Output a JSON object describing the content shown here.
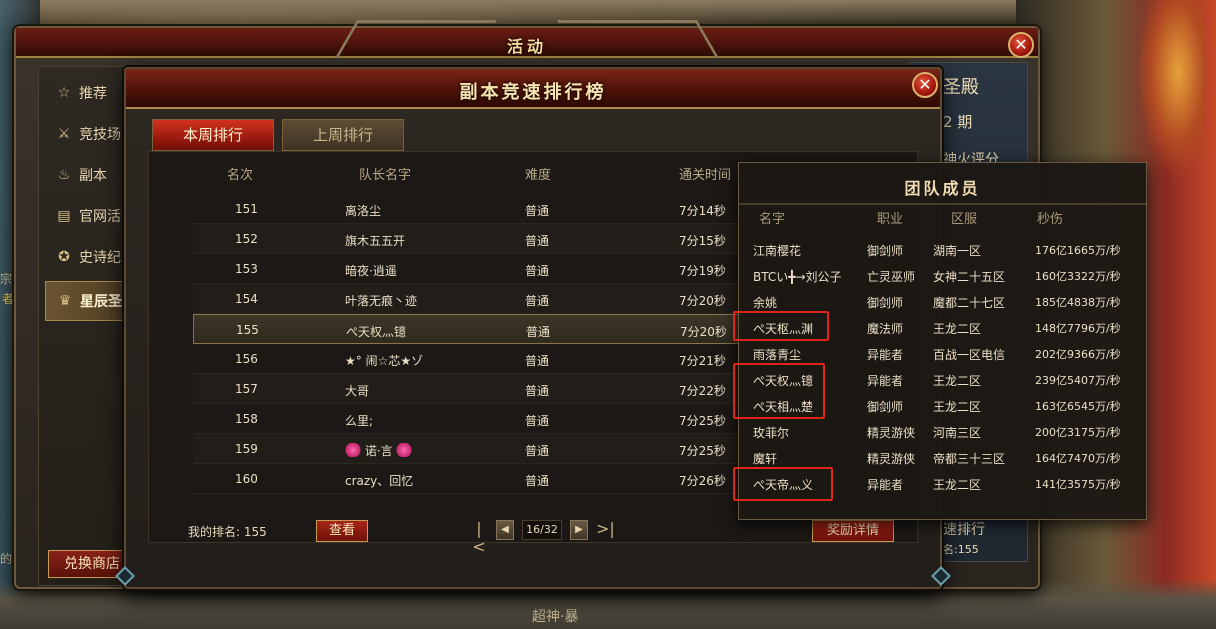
{
  "background": {
    "left_text": [
      "宗帝",
      "者",
      "的"
    ],
    "bottom_text": "超神·暴"
  },
  "outer_window": {
    "title": "活动",
    "close_glyph": "✕"
  },
  "sidebar": {
    "items": [
      {
        "label": "推荐",
        "icon": "star-icon",
        "glyph": "☆"
      },
      {
        "label": "竞技场",
        "icon": "crossed-swords-icon",
        "glyph": "⚔"
      },
      {
        "label": "副本",
        "icon": "flame-icon",
        "glyph": "♨"
      },
      {
        "label": "官网活",
        "icon": "book-icon",
        "glyph": "▤"
      },
      {
        "label": "史诗纪",
        "icon": "emblem-icon",
        "glyph": "✪"
      },
      {
        "label": "星辰圣",
        "icon": "trophy-icon",
        "glyph": "♛",
        "active": true
      }
    ],
    "shop_label": "兑换商店"
  },
  "right_panel": {
    "title": "圣殿",
    "period": "2 期",
    "subtitle": "神火评分",
    "footer_title": "速排行",
    "footer_rank": "名:155"
  },
  "dialog": {
    "title": "副本竞速排行榜",
    "close_glyph": "✕",
    "tabs": [
      "本周排行",
      "上周排行"
    ],
    "active_tab": 0,
    "columns": {
      "rank": "名次",
      "leader": "队长名字",
      "difficulty": "难度",
      "time": "通关时间"
    },
    "rows": [
      {
        "rank": "151",
        "name": "离洛尘",
        "difficulty": "普通",
        "time": "7分14秒"
      },
      {
        "rank": "152",
        "name": "旗木五五开",
        "difficulty": "普通",
        "time": "7分15秒"
      },
      {
        "rank": "153",
        "name": "暗夜·逍遥",
        "difficulty": "普通",
        "time": "7分19秒"
      },
      {
        "rank": "154",
        "name": "叶落无痕丶迹",
        "difficulty": "普通",
        "time": "7分20秒"
      },
      {
        "rank": "155",
        "name": "ぺ天权灬镱",
        "difficulty": "普通",
        "time": "7分20秒",
        "mine": true
      },
      {
        "rank": "156",
        "name": "★° 闹☆芯★ゾ",
        "difficulty": "普通",
        "time": "7分21秒"
      },
      {
        "rank": "157",
        "name": "大哥",
        "difficulty": "普通",
        "time": "7分22秒"
      },
      {
        "rank": "158",
        "name": "么里;",
        "difficulty": "普通",
        "time": "7分25秒"
      },
      {
        "rank": "159",
        "name": "诺·言",
        "difficulty": "普通",
        "time": "7分25秒",
        "hearts": true
      },
      {
        "rank": "160",
        "name": "crazy、回忆",
        "difficulty": "普通",
        "time": "7分26秒"
      }
    ],
    "my_rank": "我的排名: 155",
    "view_label": "查看",
    "pager": {
      "first": "|<",
      "prev": "◀",
      "page": "16/32",
      "next": "▶",
      "last": ">|"
    },
    "reward_label": "奖励详情"
  },
  "team": {
    "title": "团队成员",
    "columns": {
      "name": "名字",
      "job": "职业",
      "zone": "区服",
      "dps": "秒伤"
    },
    "members": [
      {
        "name": "江南樱花",
        "job": "御剑师",
        "zone": "湖南一区",
        "dps": "176亿1665万/秒"
      },
      {
        "name": "BTCい╋→刘公子",
        "job": "亡灵巫师",
        "zone": "女神二十五区",
        "dps": "160亿3322万/秒"
      },
      {
        "name": "余姚",
        "job": "御剑师",
        "zone": "魔都二十七区",
        "dps": "185亿4838万/秒"
      },
      {
        "name": "ぺ天枢灬渊",
        "job": "魔法师",
        "zone": "王龙二区",
        "dps": "148亿7796万/秒",
        "highlight": true
      },
      {
        "name": "雨落青尘",
        "job": "异能者",
        "zone": "百战一区电信",
        "dps": "202亿9366万/秒"
      },
      {
        "name": "ぺ天权灬镱",
        "job": "异能者",
        "zone": "王龙二区",
        "dps": "239亿5407万/秒",
        "highlight": true
      },
      {
        "name": "ぺ天相灬楚",
        "job": "御剑师",
        "zone": "王龙二区",
        "dps": "163亿6545万/秒",
        "highlight": true
      },
      {
        "name": "玫菲尔",
        "job": "精灵游侠",
        "zone": "河南三区",
        "dps": "200亿3175万/秒"
      },
      {
        "name": "魔轩",
        "job": "精灵游侠",
        "zone": "帝都三十三区",
        "dps": "164亿7470万/秒"
      },
      {
        "name": "ぺ天帝灬义",
        "job": "异能者",
        "zone": "王龙二区",
        "dps": "141亿3575万/秒",
        "highlight": true
      }
    ]
  },
  "colors": {
    "accent_red": "#d23220",
    "gold_border": "#c69a52",
    "highlight_box": "#e0241a"
  }
}
